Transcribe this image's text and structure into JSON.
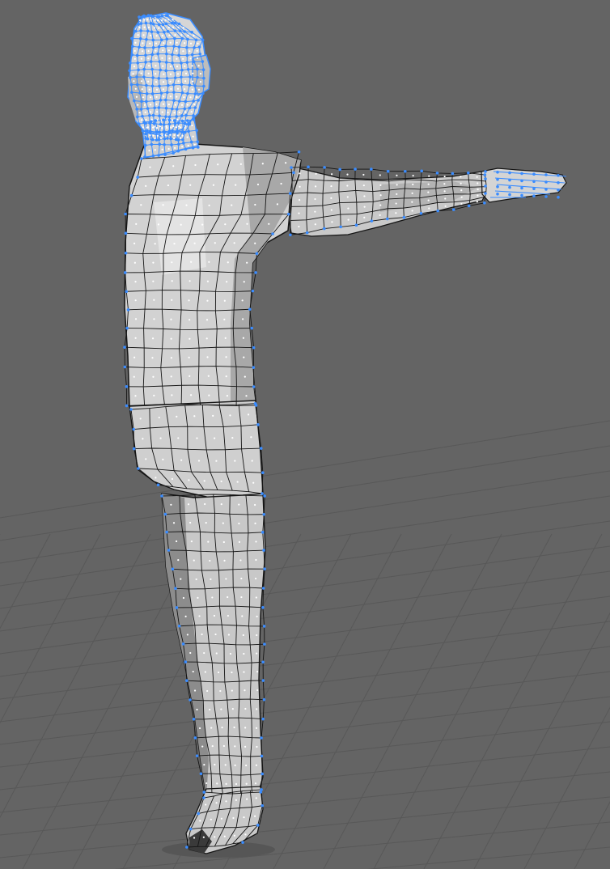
{
  "viewport": {
    "background_color": "#646464",
    "grid_line_color": "#585858",
    "mesh_fill_light": "#e0e0e0",
    "mesh_fill_mid": "#c4c4c4",
    "mesh_fill_dark": "#8c8c8c",
    "edge_color": "#151515",
    "selection_color": "#3a8cff",
    "vertex_dot_color": "#ffffff"
  },
  "scene": {
    "object": "humanoid-base-mesh",
    "selection_mode": "edges",
    "selected_regions": [
      "head",
      "neck",
      "arm",
      "hand",
      "outline"
    ]
  }
}
